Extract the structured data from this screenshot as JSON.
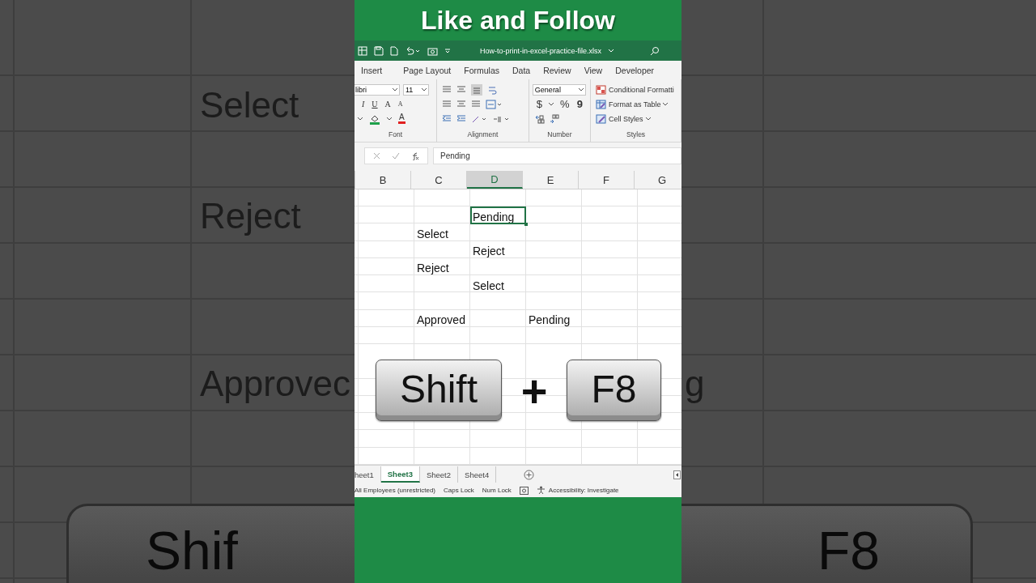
{
  "backdrop_left": {
    "cells": [
      "Select",
      "Reject",
      "Approvec"
    ],
    "key": "Shif"
  },
  "backdrop_right": {
    "cells": [
      "g"
    ],
    "key": "F8"
  },
  "banner": {
    "title": "Like and Follow"
  },
  "title_bar": {
    "filename": "How-to-print-in-excel-practice-file.xlsx"
  },
  "ribbon_tabs": [
    {
      "label": "Insert",
      "selected": false
    },
    {
      "label": "Page Layout",
      "selected": false
    },
    {
      "label": "Formulas",
      "selected": false
    },
    {
      "label": "Data",
      "selected": false
    },
    {
      "label": "Review",
      "selected": false
    },
    {
      "label": "View",
      "selected": false
    },
    {
      "label": "Developer",
      "selected": false
    }
  ],
  "ribbon": {
    "font_name": "libri",
    "font_size": "11",
    "number_format": "General",
    "font_buttons": [
      "I",
      "U",
      "A",
      "A"
    ],
    "font_color": "A",
    "number_symbols": [
      "$",
      "%",
      "9"
    ],
    "styles_items": [
      "Conditional Formatti",
      "Format as Table",
      "Cell Styles"
    ],
    "group_labels": [
      "Font",
      "Alignment",
      "Number",
      "Styles"
    ]
  },
  "formula_bar": {
    "value": "Pending"
  },
  "columns": [
    {
      "label": "B",
      "selected": false
    },
    {
      "label": "C",
      "selected": false
    },
    {
      "label": "D",
      "selected": true
    },
    {
      "label": "E",
      "selected": false
    },
    {
      "label": "F",
      "selected": false
    },
    {
      "label": "G",
      "selected": false
    }
  ],
  "rows": [
    {
      "cells": [
        null,
        null,
        null,
        null,
        null,
        null
      ]
    },
    {
      "cells": [
        null,
        null,
        {
          "text": "Pending",
          "selected": true
        },
        null,
        null,
        null
      ]
    },
    {
      "cells": [
        null,
        {
          "text": "Select",
          "selected": false
        },
        null,
        null,
        null,
        null
      ]
    },
    {
      "cells": [
        null,
        null,
        {
          "text": "Reject",
          "selected": false
        },
        null,
        null,
        null
      ]
    },
    {
      "cells": [
        null,
        {
          "text": "Reject",
          "selected": false
        },
        null,
        null,
        null,
        null
      ]
    },
    {
      "cells": [
        null,
        null,
        {
          "text": "Select",
          "selected": false
        },
        null,
        null,
        null
      ]
    },
    {
      "cells": [
        null,
        null,
        null,
        null,
        null,
        null
      ]
    },
    {
      "cells": [
        null,
        {
          "text": "Approved",
          "selected": false
        },
        null,
        {
          "text": "Pending",
          "selected": false
        },
        null,
        null
      ]
    },
    {
      "cells": [
        null,
        null,
        null,
        null,
        null,
        null
      ]
    },
    {
      "cells": [
        null,
        null,
        null,
        null,
        null,
        null
      ]
    },
    {
      "cells": [
        null,
        null,
        null,
        null,
        null,
        null
      ]
    },
    {
      "cells": [
        null,
        null,
        null,
        null,
        null,
        null
      ]
    },
    {
      "cells": [
        null,
        null,
        null,
        null,
        null,
        null
      ]
    },
    {
      "cells": [
        null,
        null,
        null,
        null,
        null,
        null
      ]
    },
    {
      "cells": [
        null,
        null,
        null,
        null,
        null,
        null
      ]
    },
    {
      "cells": [
        null,
        null,
        null,
        null,
        null,
        null
      ]
    }
  ],
  "shortcut": {
    "keys": [
      "Shift",
      "F8"
    ],
    "joiner": "+"
  },
  "sheet_tabs": [
    {
      "label": "heet1",
      "selected": false
    },
    {
      "label": "Sheet3",
      "selected": true
    },
    {
      "label": "Sheet2",
      "selected": false
    },
    {
      "label": "Sheet4",
      "selected": false
    }
  ],
  "status_bar": [
    "All Employees (unrestricted)",
    "Caps Lock",
    "Num Lock",
    "Accessibility: Investigate"
  ]
}
